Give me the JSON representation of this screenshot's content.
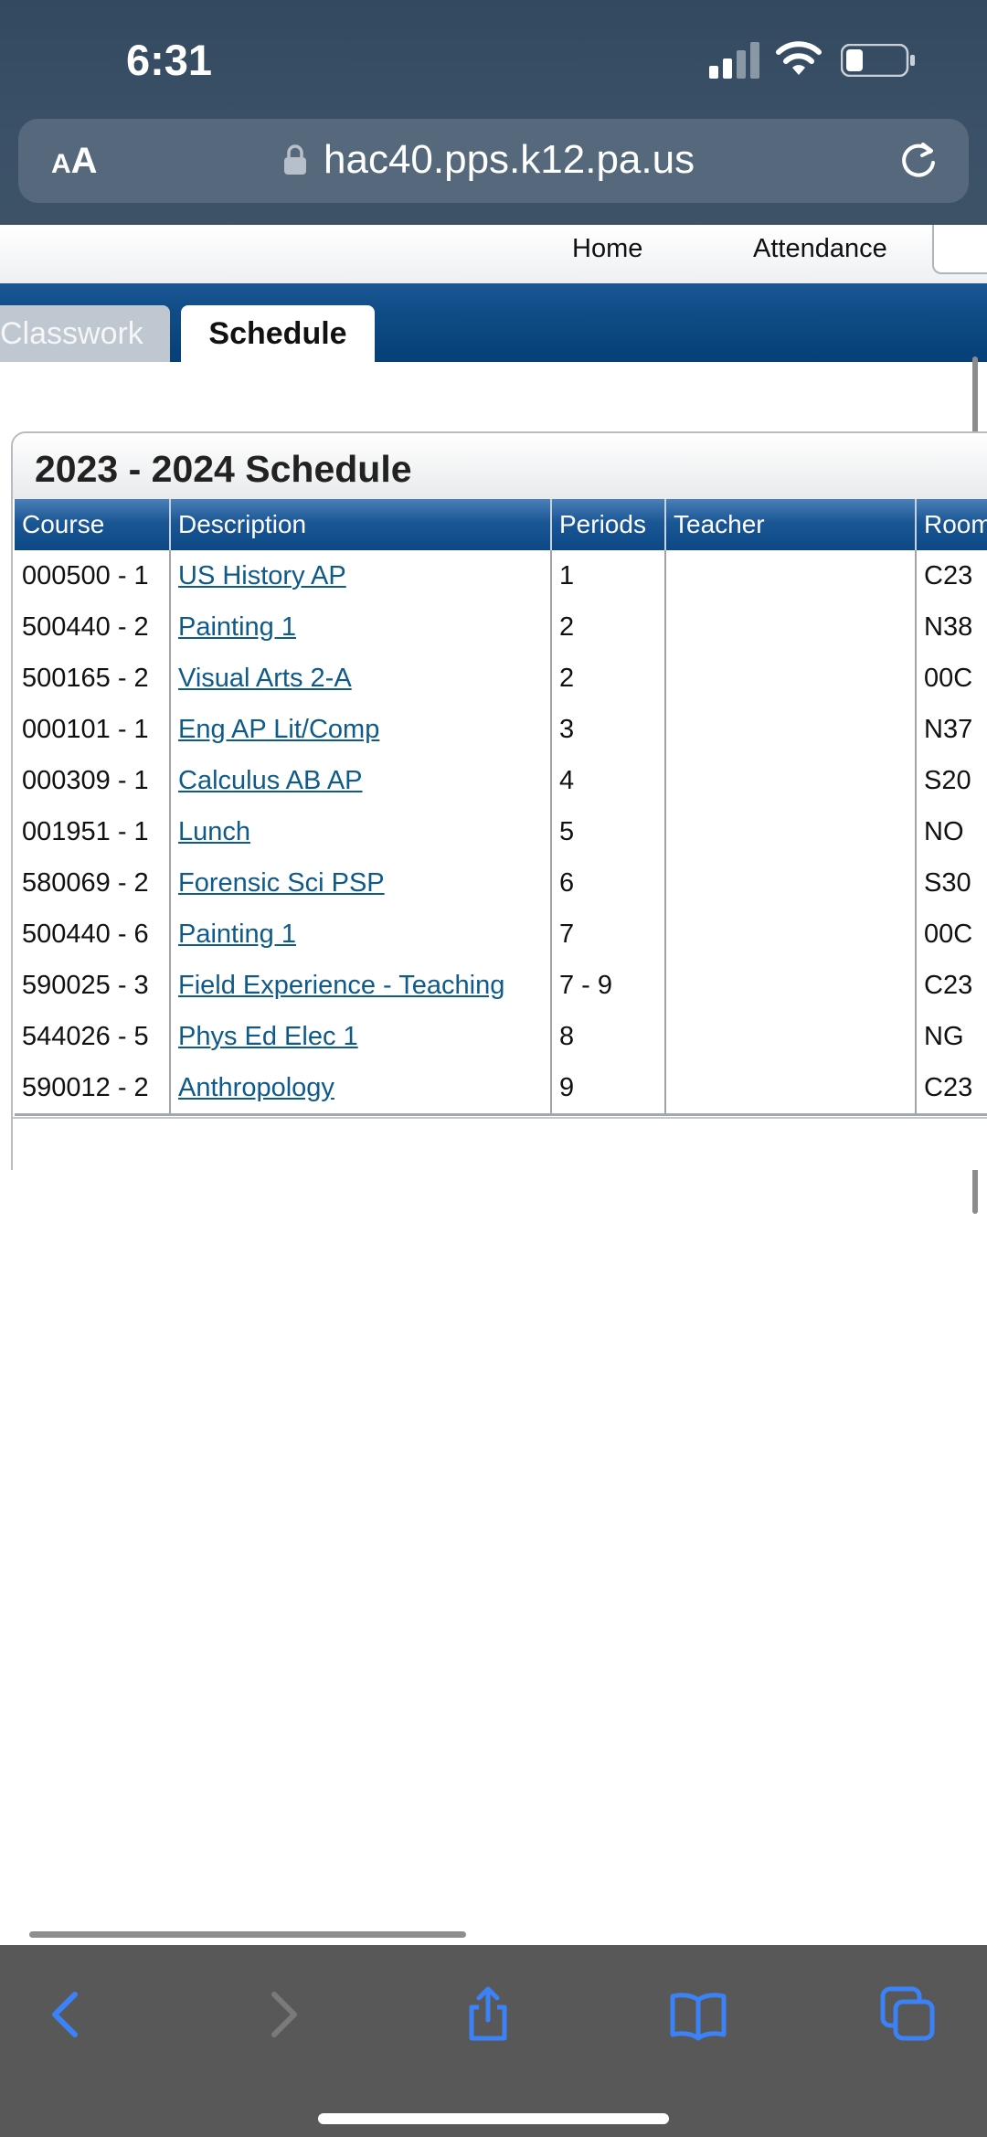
{
  "status_bar": {
    "time": "6:31"
  },
  "browser": {
    "text_size_button": {
      "small": "A",
      "large": "A"
    },
    "url": "hac40.pps.k12.pa.us",
    "icons": [
      "lock-icon",
      "reload-icon",
      "back-icon",
      "forward-icon",
      "share-icon",
      "bookmarks-icon",
      "tabs-icon"
    ],
    "icon_color": "#3b82f6"
  },
  "nav": {
    "home": "Home",
    "attendance": "Attendance"
  },
  "tabs": {
    "classwork": "Classwork",
    "schedule": "Schedule"
  },
  "schedule": {
    "title": "2023 - 2024 Schedule",
    "columns": [
      "Course",
      "Description",
      "Periods",
      "Teacher",
      "Room"
    ],
    "rows": [
      {
        "course": "000500 - 1",
        "description": "US History AP",
        "periods": "1",
        "teacher": "",
        "room": "C23"
      },
      {
        "course": "500440 - 2",
        "description": "Painting 1",
        "periods": "2",
        "teacher": "",
        "room": "N38"
      },
      {
        "course": "500165 - 2",
        "description": "Visual Arts 2-A",
        "periods": "2",
        "teacher": "",
        "room": "00C"
      },
      {
        "course": "000101 - 1",
        "description": "Eng AP Lit/Comp",
        "periods": "3",
        "teacher": "",
        "room": "N37"
      },
      {
        "course": "000309 - 1",
        "description": "Calculus AB AP",
        "periods": "4",
        "teacher": "",
        "room": "S20"
      },
      {
        "course": "001951 - 1",
        "description": "Lunch",
        "periods": "5",
        "teacher": "",
        "room": "NO"
      },
      {
        "course": "580069 - 2",
        "description": "Forensic Sci PSP",
        "periods": "6",
        "teacher": "",
        "room": "S30"
      },
      {
        "course": "500440 - 6",
        "description": "Painting 1",
        "periods": "7",
        "teacher": "",
        "room": "00C"
      },
      {
        "course": "590025 - 3",
        "description": "Field Experience - Teaching",
        "periods": "7 - 9",
        "teacher": "",
        "room": "C23"
      },
      {
        "course": "544026 - 5",
        "description": "Phys Ed Elec 1",
        "periods": "8",
        "teacher": "",
        "room": "NG"
      },
      {
        "course": "590012 - 2",
        "description": "Anthropology",
        "periods": "9",
        "teacher": "",
        "room": "C23"
      }
    ]
  },
  "colors": {
    "tab_band": "#0f4c86",
    "header_row": "#1b5795",
    "link": "#0e5a8a",
    "browser_chrome": "#3b5167",
    "toolbar": "#585858"
  }
}
